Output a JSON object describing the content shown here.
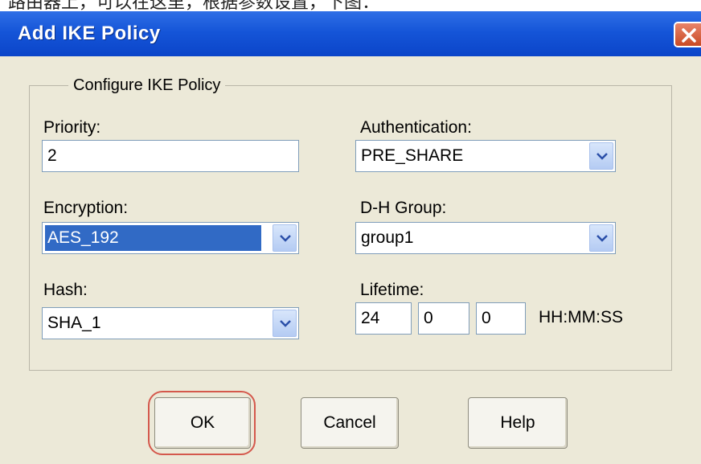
{
  "caption": "路由器上，可以在这里，根据参数设置，下图：",
  "window": {
    "title": "Add IKE Policy"
  },
  "group": {
    "title": "Configure IKE Policy"
  },
  "fields": {
    "priority": {
      "label": "Priority:",
      "value": "2"
    },
    "authentication": {
      "label": "Authentication:",
      "value": "PRE_SHARE"
    },
    "encryption": {
      "label": "Encryption:",
      "value": "AES_192"
    },
    "dh_group": {
      "label": "D-H Group:",
      "value": "group1"
    },
    "hash": {
      "label": "Hash:",
      "value": "SHA_1"
    },
    "lifetime": {
      "label": "Lifetime:",
      "hours": "24",
      "minutes": "0",
      "seconds": "0",
      "format": "HH:MM:SS"
    }
  },
  "buttons": {
    "ok": "OK",
    "cancel": "Cancel",
    "help": "Help"
  },
  "icons": {
    "close": "close-icon",
    "dropdown": "chevron-down-icon"
  },
  "colors": {
    "titlebar": "#1555d8",
    "selection": "#316ac5",
    "highlight": "#d4584c"
  }
}
